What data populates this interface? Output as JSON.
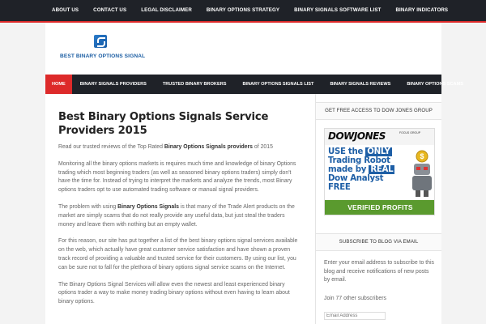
{
  "top_nav": {
    "items": [
      "ABOUT US",
      "CONTACT US",
      "LEGAL DISCLAIMER",
      "BINARY OPTIONS STRATEGY",
      "BINARY SIGNALS SOFTWARE LIST",
      "BINARY INDICATORS"
    ]
  },
  "header": {
    "logo_text": "BEST BINARY OPTIONS SIGNAL"
  },
  "main_nav": {
    "items": [
      "HOME",
      "BINARY SIGNALS PROVIDERS",
      "TRUSTED BINARY BROKERS",
      "BINARY OPTIONS SIGNALS LIST",
      "BINARY SIGNALS REVIEWS",
      "BINARY OPTIONS SCAMS"
    ],
    "active_index": 0
  },
  "article": {
    "title": "Best Binary Options Signals Service Providers 2015",
    "intro_pre": "Read our trusted reviews of the Top Rated ",
    "intro_bold": "Binary Options Signals providers",
    "intro_post": " of 2015",
    "p1": "Monitoring all the binary options markets is requires much time and knowledge of binary Options trading which most beginning traders (as well as seasoned binary options traders) simply don't have the time for. Instead of trying to interpret the markets and analyze the trends, most Binary options traders opt to use automated trading software or manual signal providers.",
    "p2_pre": "The problem with using ",
    "p2_bold": "Binary Options Signals",
    "p2_post": " is that many of the Trade Alert products on the market are simply scams that do not really provide any useful data, but just steal the traders money and leave them with nothing but an empty wallet.",
    "p3": "For this reason, our site has put together a list of the best binary options signal services available on the web, which actually have great customer service satisfaction and have shown a proven track record of providing a valuable and trusted service for their customers. By using our list, you can be sure not to fall for the plethora of binary options signal service scams on the Internet.",
    "p4": "The Binary Options Signal Services will allow even the newest and least experienced binary options trader a way to make money trading binary options without even having to learn about binary options."
  },
  "sidebar": {
    "widget1_title": "GET FREE ACCESS TO DOW JONES GROUP",
    "ad": {
      "brand": "DOWJONES",
      "focus_label": "FOCUS GROUP",
      "line1_pre": "USE the ",
      "line1_hl": "ONLY",
      "line2": "Trading Robot",
      "line3_pre": "made by ",
      "line3_hl": "REAL",
      "line4": "Dow Analyst",
      "line5": "FREE",
      "button": "VERIFIED PROFITS"
    },
    "widget2_title": "SUBSCRIBE TO BLOG VIA EMAIL",
    "subscribe_text": "Enter your email address to subscribe to this blog and receive notifications of new posts by email.",
    "subscriber_count": "Join 77 other subscribers",
    "email_placeholder": "Email Address"
  }
}
